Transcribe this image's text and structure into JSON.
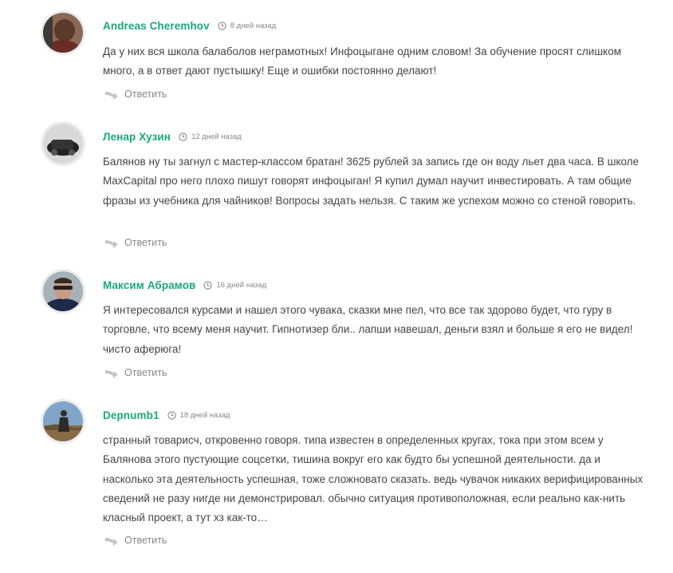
{
  "comments": [
    {
      "author": "Andreas Cheremhov",
      "date": "8 дней назад",
      "text": "Да у них вся школа балаболов неграмотных! Инфоцыгане одним словом! За обучение просят слишком много, а в ответ дают пустышку! Еще и ошибки постоянно делают!",
      "reply_label": "Ответить"
    },
    {
      "author": "Ленар Хузин",
      "date": "12 дней назад",
      "text": "Балянов ну ты загнул с мастер-классом братан! 3625 рублей за запись где он воду льет два часа. В школе MaxCapital про него плохо пишут говорят инфоцыган! Я купил думал научит инвестировать. А там общие фразы из учебника для чайников! Вопросы задать нельзя. С таким же успехом можно со стеной говорить.",
      "reply_label": "Ответить"
    },
    {
      "author": "Максим Абрамов",
      "date": "16 дней назад",
      "text": "Я интересовался курсами и нашел этого чувака, сказки мне пел, что все так здорово будет, что гуру в торговле, что всему меня научит. Гипнотизер бли.. лапши навешал, деньги взял и больше я его не видел! чисто аферюга!",
      "reply_label": "Ответить"
    },
    {
      "author": "Depnumb1",
      "date": "18 дней назад",
      "text": "странный товарисч, откровенно говоря. типа известен в определенных кругах, тока при этом всем у Балянова этого пустующие соцсетки, тишина вокруг его как будто бы успешной деятельности. да и насколько эта деятельность успешная, тоже сложновато сказать. ведь чувачок никаких верифицированных сведений не разу нигде ни демонстрировал. обычно ситуация противоположная, если реально как-нить класный проект, а тут хз как-то…",
      "reply_label": "Ответить"
    }
  ],
  "colors": {
    "author": "#1aa87b",
    "meta": "#888888",
    "text": "#454545"
  },
  "icons": {
    "date": "clock-icon",
    "reply": "reply-arrow-icon"
  }
}
